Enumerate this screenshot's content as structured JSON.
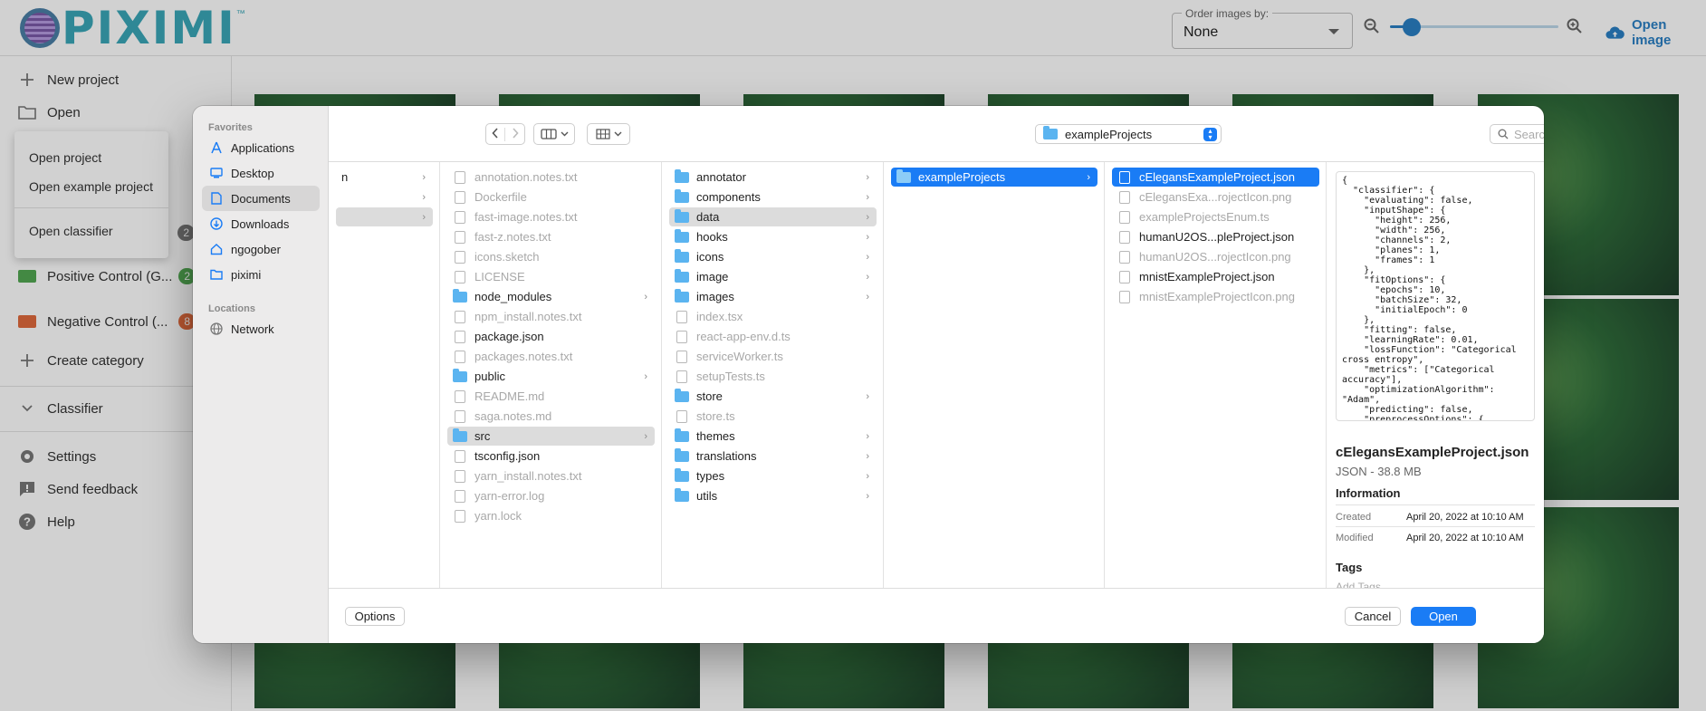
{
  "app": {
    "logo_text": "PIXIMI",
    "logo_tm": "™",
    "order_label": "Order images by:",
    "order_value": "None",
    "zoom_value": 0.13,
    "open_image_label": "Open image",
    "sidebar": {
      "new_project": "New project",
      "open": "Open",
      "categories": [
        {
          "label": "Positive Control (G...",
          "count": "2",
          "color": "#52a852"
        },
        {
          "label": "Negative Control (...",
          "count": "8",
          "color": "#e06a3c"
        }
      ],
      "hidden_badge": "2",
      "create_category": "Create category",
      "classifier": "Classifier",
      "settings": "Settings",
      "send_feedback": "Send feedback",
      "help": "Help"
    },
    "open_menu": {
      "items": [
        "Open project",
        "Open example project",
        "Open classifier"
      ]
    }
  },
  "dialog": {
    "favorites_header": "Favorites",
    "favorites": [
      "Applications",
      "Desktop",
      "Documents",
      "Downloads",
      "ngogober",
      "piximi"
    ],
    "locations_header": "Locations",
    "locations": [
      "Network"
    ],
    "current_folder": "exampleProjects",
    "search_placeholder": "Search",
    "col0": [
      {
        "name": "n",
        "chev": true
      },
      {
        "name": "",
        "chev": true
      },
      {
        "name": "",
        "chev": true,
        "state": "gray"
      }
    ],
    "col1": [
      {
        "name": "annotation.notes.txt",
        "dim": true
      },
      {
        "name": "Dockerfile",
        "dim": true
      },
      {
        "name": "fast-image.notes.txt",
        "dim": true
      },
      {
        "name": "fast-z.notes.txt",
        "dim": true
      },
      {
        "name": "icons.sketch",
        "dim": true
      },
      {
        "name": "LICENSE",
        "dim": true
      },
      {
        "name": "node_modules",
        "folder": true,
        "chev": true
      },
      {
        "name": "npm_install.notes.txt",
        "dim": true
      },
      {
        "name": "package.json"
      },
      {
        "name": "packages.notes.txt",
        "dim": true
      },
      {
        "name": "public",
        "folder": true,
        "chev": true
      },
      {
        "name": "README.md",
        "dim": true
      },
      {
        "name": "saga.notes.md",
        "dim": true
      },
      {
        "name": "src",
        "folder": true,
        "chev": true,
        "state": "gray"
      },
      {
        "name": "tsconfig.json"
      },
      {
        "name": "yarn_install.notes.txt",
        "dim": true
      },
      {
        "name": "yarn-error.log",
        "dim": true
      },
      {
        "name": "yarn.lock",
        "dim": true
      }
    ],
    "col2": [
      {
        "name": "annotator",
        "folder": true,
        "chev": true
      },
      {
        "name": "components",
        "folder": true,
        "chev": true
      },
      {
        "name": "data",
        "folder": true,
        "chev": true,
        "state": "gray"
      },
      {
        "name": "hooks",
        "folder": true,
        "chev": true
      },
      {
        "name": "icons",
        "folder": true,
        "chev": true
      },
      {
        "name": "image",
        "folder": true,
        "chev": true
      },
      {
        "name": "images",
        "folder": true,
        "chev": true
      },
      {
        "name": "index.tsx",
        "dim": true
      },
      {
        "name": "react-app-env.d.ts",
        "dim": true
      },
      {
        "name": "serviceWorker.ts",
        "dim": true
      },
      {
        "name": "setupTests.ts",
        "dim": true
      },
      {
        "name": "store",
        "folder": true,
        "chev": true
      },
      {
        "name": "store.ts",
        "dim": true
      },
      {
        "name": "themes",
        "folder": true,
        "chev": true
      },
      {
        "name": "translations",
        "folder": true,
        "chev": true
      },
      {
        "name": "types",
        "folder": true,
        "chev": true
      },
      {
        "name": "utils",
        "folder": true,
        "chev": true
      }
    ],
    "col3": [
      {
        "name": "exampleProjects",
        "folder": true,
        "chev": true,
        "state": "blue"
      }
    ],
    "col4": [
      {
        "name": "cElegansExampleProject.json",
        "state": "blue"
      },
      {
        "name": "cElegansExa...rojectIcon.png",
        "dim": true
      },
      {
        "name": "exampleProjectsEnum.ts",
        "dim": true
      },
      {
        "name": "humanU2OS...pleProject.json"
      },
      {
        "name": "humanU2OS...rojectIcon.png",
        "dim": true
      },
      {
        "name": "mnistExampleProject.json"
      },
      {
        "name": "mnistExampleProjectIcon.png",
        "dim": true
      }
    ],
    "preview": {
      "json_text": "{\n  \"classifier\": {\n    \"evaluating\": false,\n    \"inputShape\": {\n      \"height\": 256,\n      \"width\": 256,\n      \"channels\": 2,\n      \"planes\": 1,\n      \"frames\": 1\n    },\n    \"fitOptions\": {\n      \"epochs\": 10,\n      \"batchSize\": 32,\n      \"initialEpoch\": 0\n    },\n    \"fitting\": false,\n    \"learningRate\": 0.01,\n    \"lossFunction\": \"Categorical\ncross entropy\",\n    \"metrics\": [\"Categorical\naccuracy\"],\n    \"optimizationAlgorithm\":\n\"Adam\",\n    \"predicting\": false,\n    \"preprocessOptions\": {",
      "file_name": "cElegansExampleProject.json",
      "file_kind": "JSON - 38.8 MB",
      "info_header": "Information",
      "created_label": "Created",
      "created_value": "April 20, 2022 at 10:10 AM",
      "modified_label": "Modified",
      "modified_value": "April 20, 2022 at 10:10 AM",
      "tags_header": "Tags",
      "add_tags": "Add Tags..."
    },
    "options_label": "Options",
    "cancel_label": "Cancel",
    "open_label": "Open"
  }
}
